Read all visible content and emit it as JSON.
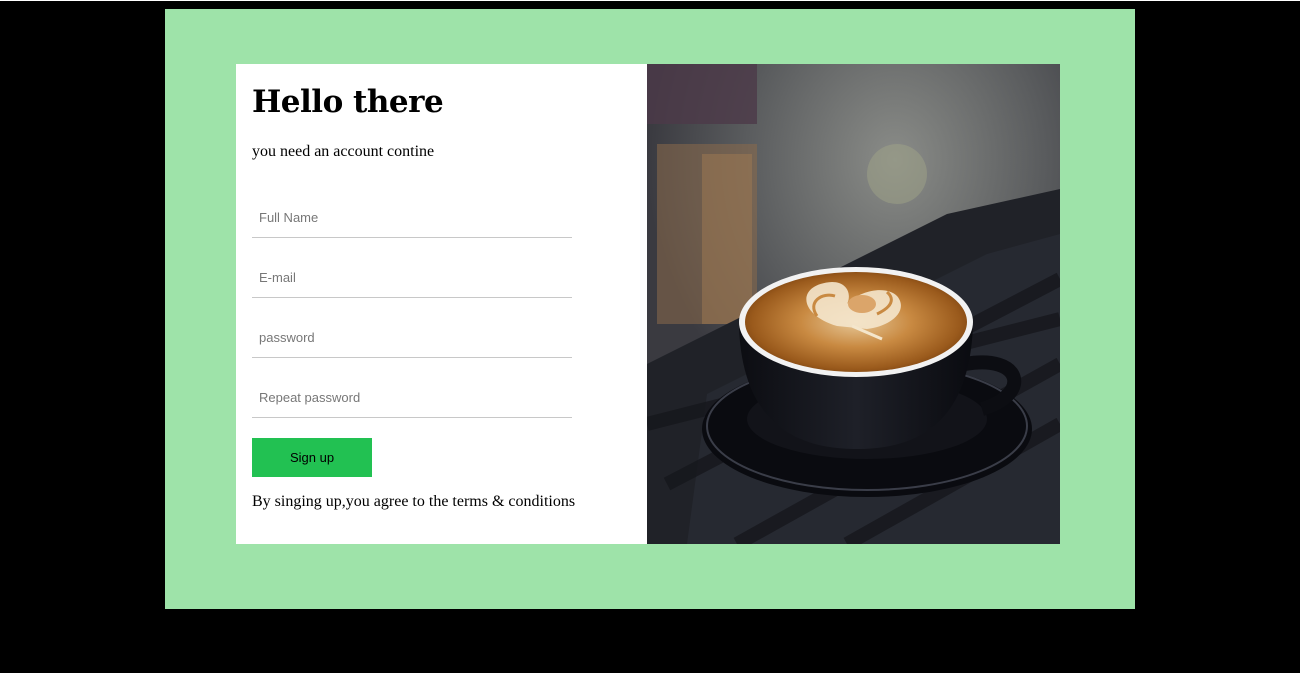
{
  "form": {
    "heading": "Hello there",
    "subtitle": "you need an account contine",
    "fields": [
      {
        "placeholder": "Full Name",
        "value": ""
      },
      {
        "placeholder": "E-mail",
        "value": ""
      },
      {
        "placeholder": "password",
        "value": ""
      },
      {
        "placeholder": "Repeat password",
        "value": ""
      }
    ],
    "submit_label": "Sign up",
    "terms_text": "By singing up,you agree to the terms & conditions"
  },
  "image": {
    "subject": "latte-art-coffee-cup-photo"
  },
  "colors": {
    "page_background": "#000000",
    "frame_background": "#9ee3a9",
    "form_background": "#ffffff",
    "button_background": "#22c152",
    "field_underline": "#c8c8c8"
  }
}
